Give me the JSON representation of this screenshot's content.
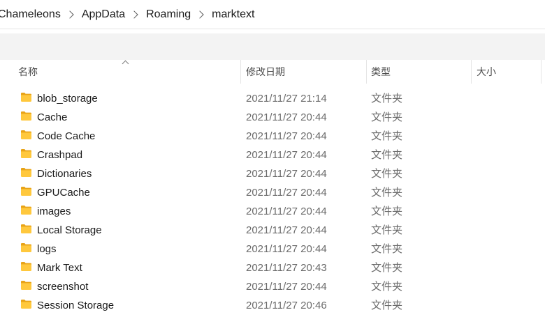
{
  "breadcrumb": {
    "items": [
      "Chameleons",
      "AppData",
      "Roaming",
      "marktext"
    ]
  },
  "columns": {
    "name": "名称",
    "date": "修改日期",
    "type": "类型",
    "size": "大小"
  },
  "colors": {
    "folder_body": "#FFC83D",
    "folder_tab": "#E8A317"
  },
  "rows": [
    {
      "name": "blob_storage",
      "date": "2021/11/27 21:14",
      "type": "文件夹",
      "size": ""
    },
    {
      "name": "Cache",
      "date": "2021/11/27 20:44",
      "type": "文件夹",
      "size": ""
    },
    {
      "name": "Code Cache",
      "date": "2021/11/27 20:44",
      "type": "文件夹",
      "size": ""
    },
    {
      "name": "Crashpad",
      "date": "2021/11/27 20:44",
      "type": "文件夹",
      "size": ""
    },
    {
      "name": "Dictionaries",
      "date": "2021/11/27 20:44",
      "type": "文件夹",
      "size": ""
    },
    {
      "name": "GPUCache",
      "date": "2021/11/27 20:44",
      "type": "文件夹",
      "size": ""
    },
    {
      "name": "images",
      "date": "2021/11/27 20:44",
      "type": "文件夹",
      "size": ""
    },
    {
      "name": "Local Storage",
      "date": "2021/11/27 20:44",
      "type": "文件夹",
      "size": ""
    },
    {
      "name": "logs",
      "date": "2021/11/27 20:44",
      "type": "文件夹",
      "size": ""
    },
    {
      "name": "Mark Text",
      "date": "2021/11/27 20:43",
      "type": "文件夹",
      "size": ""
    },
    {
      "name": "screenshot",
      "date": "2021/11/27 20:44",
      "type": "文件夹",
      "size": ""
    },
    {
      "name": "Session Storage",
      "date": "2021/11/27 20:46",
      "type": "文件夹",
      "size": ""
    }
  ]
}
